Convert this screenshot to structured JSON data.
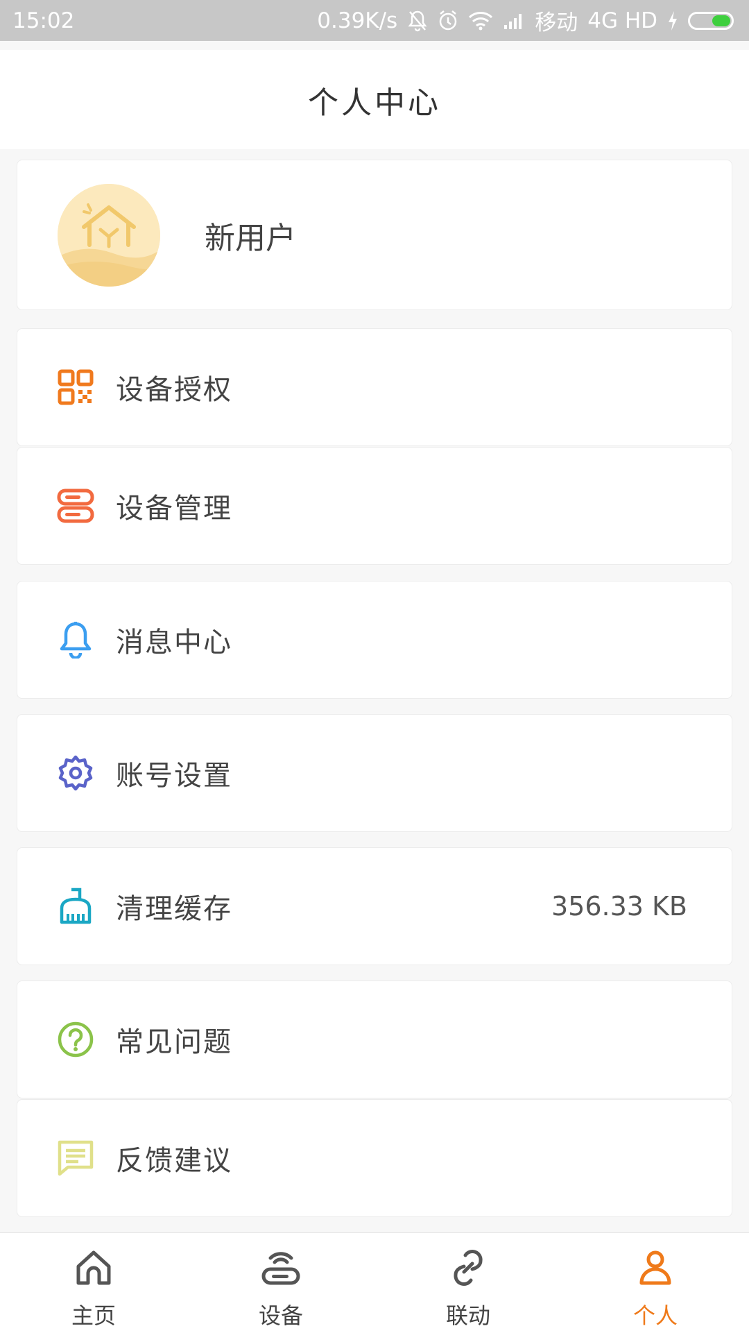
{
  "status_bar": {
    "time": "15:02",
    "speed": "0.39K/s",
    "carrier": "移动",
    "network": "4G HD",
    "icons": [
      "mute-bell-icon",
      "alarm-icon",
      "wifi-icon",
      "signal-icon",
      "charging-icon",
      "battery-icon"
    ]
  },
  "header": {
    "title": "个人中心"
  },
  "profile": {
    "username": "新用户",
    "avatar_icon": "house-avatar-icon"
  },
  "menu": [
    {
      "label": "设备授权",
      "icon": "qr-code-icon",
      "color": "#f07a1e"
    },
    {
      "label": "设备管理",
      "icon": "server-icon",
      "color": "#f26a3f"
    },
    {
      "label": "消息中心",
      "icon": "bell-icon",
      "color": "#3b9ef0"
    },
    {
      "label": "账号设置",
      "icon": "gear-icon",
      "color": "#5a63c9"
    },
    {
      "label": "清理缓存",
      "icon": "broom-icon",
      "color": "#1aa7c4",
      "value": "356.33 KB"
    },
    {
      "label": "常见问题",
      "icon": "help-circle-icon",
      "color": "#8bc34a"
    },
    {
      "label": "反馈建议",
      "icon": "feedback-icon",
      "color": "#e0e08a"
    }
  ],
  "tabs": [
    {
      "label": "主页",
      "icon": "home-icon",
      "active": false
    },
    {
      "label": "设备",
      "icon": "router-icon",
      "active": false
    },
    {
      "label": "联动",
      "icon": "link-icon",
      "active": false
    },
    {
      "label": "个人",
      "icon": "person-icon",
      "active": true
    }
  ],
  "colors": {
    "accent": "#ef7a1a",
    "tab_inactive": "#555555"
  }
}
